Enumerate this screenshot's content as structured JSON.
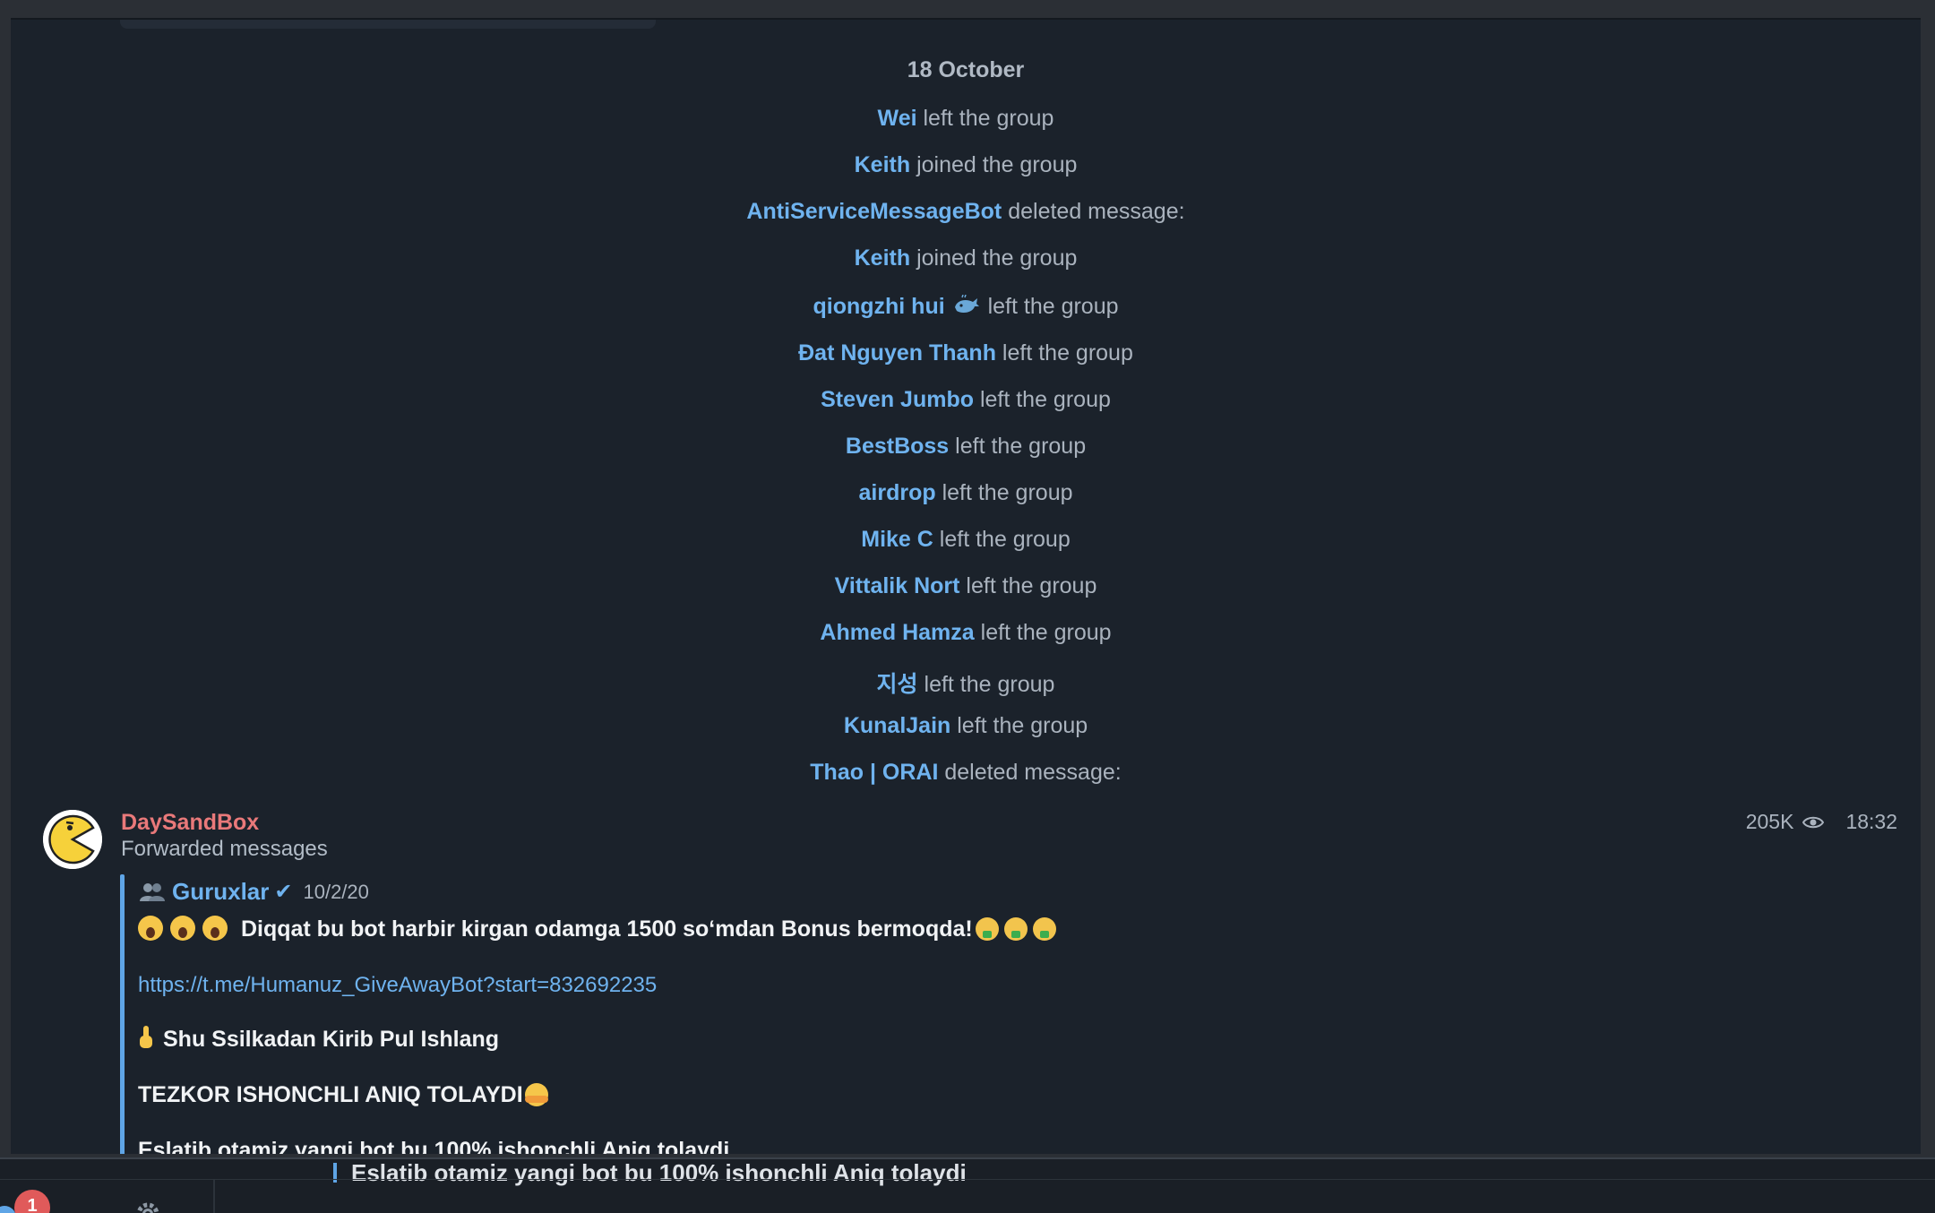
{
  "chat": {
    "date_separator": "18 October",
    "service_messages": [
      {
        "actor": "Wei",
        "action": "left the group"
      },
      {
        "actor": "Keith",
        "action": "joined the group"
      },
      {
        "actor": "AntiServiceMessageBot",
        "action": "deleted message:"
      },
      {
        "actor": "Keith",
        "action": "joined the group"
      },
      {
        "actor": "qiongzhi hui",
        "emoji": "whale-icon",
        "action": "left the group"
      },
      {
        "actor": "Đat Nguyen Thanh",
        "action": "left the group"
      },
      {
        "actor": "Steven Jumbo",
        "action": "left the group"
      },
      {
        "actor": "BestBoss",
        "action": "left the group"
      },
      {
        "actor": "airdrop",
        "action": "left the group"
      },
      {
        "actor": "Mike C",
        "action": "left the group"
      },
      {
        "actor": "Vittalik Nort",
        "action": "left the group"
      },
      {
        "actor": "Ahmed Hamza",
        "action": "left the group"
      },
      {
        "actor": "지성",
        "action": "left the group"
      },
      {
        "actor": "KunalJain",
        "action": "left the group"
      },
      {
        "actor": "Thao | ORAI",
        "action": "deleted message:"
      }
    ],
    "message": {
      "sender": "DaySandBox",
      "subtitle": "Forwarded messages",
      "views": "205K",
      "time": "18:32",
      "forward_from": {
        "name": "Guruxlar",
        "verified_mark": "✔",
        "date": "10/2/20"
      },
      "lines": {
        "headline": "Diqqat bu bot harbir kirgan odamga 1500 so‘mdan Bonus bermoqda!",
        "link": "https://t.me/Humanuz_GiveAwayBot?start=832692235",
        "cta": "Shu Ssilkadan Kirib Pul Ishlang",
        "claim": "TEZKOR ISHONCHLI ANIQ TOLAYDI",
        "reminder": "Eslatib otamiz yangi bot bu 100% ishonchli Aniq tolaydi"
      }
    }
  },
  "bottom": {
    "preview_text": "Eslatib otamiz yangi bot bu 100% ishonchli Aniq tolaydi",
    "unread_badge": "1"
  },
  "colors": {
    "accent": "#6fb3ef",
    "sender_name": "#e9797a",
    "background": "#1b222b"
  }
}
